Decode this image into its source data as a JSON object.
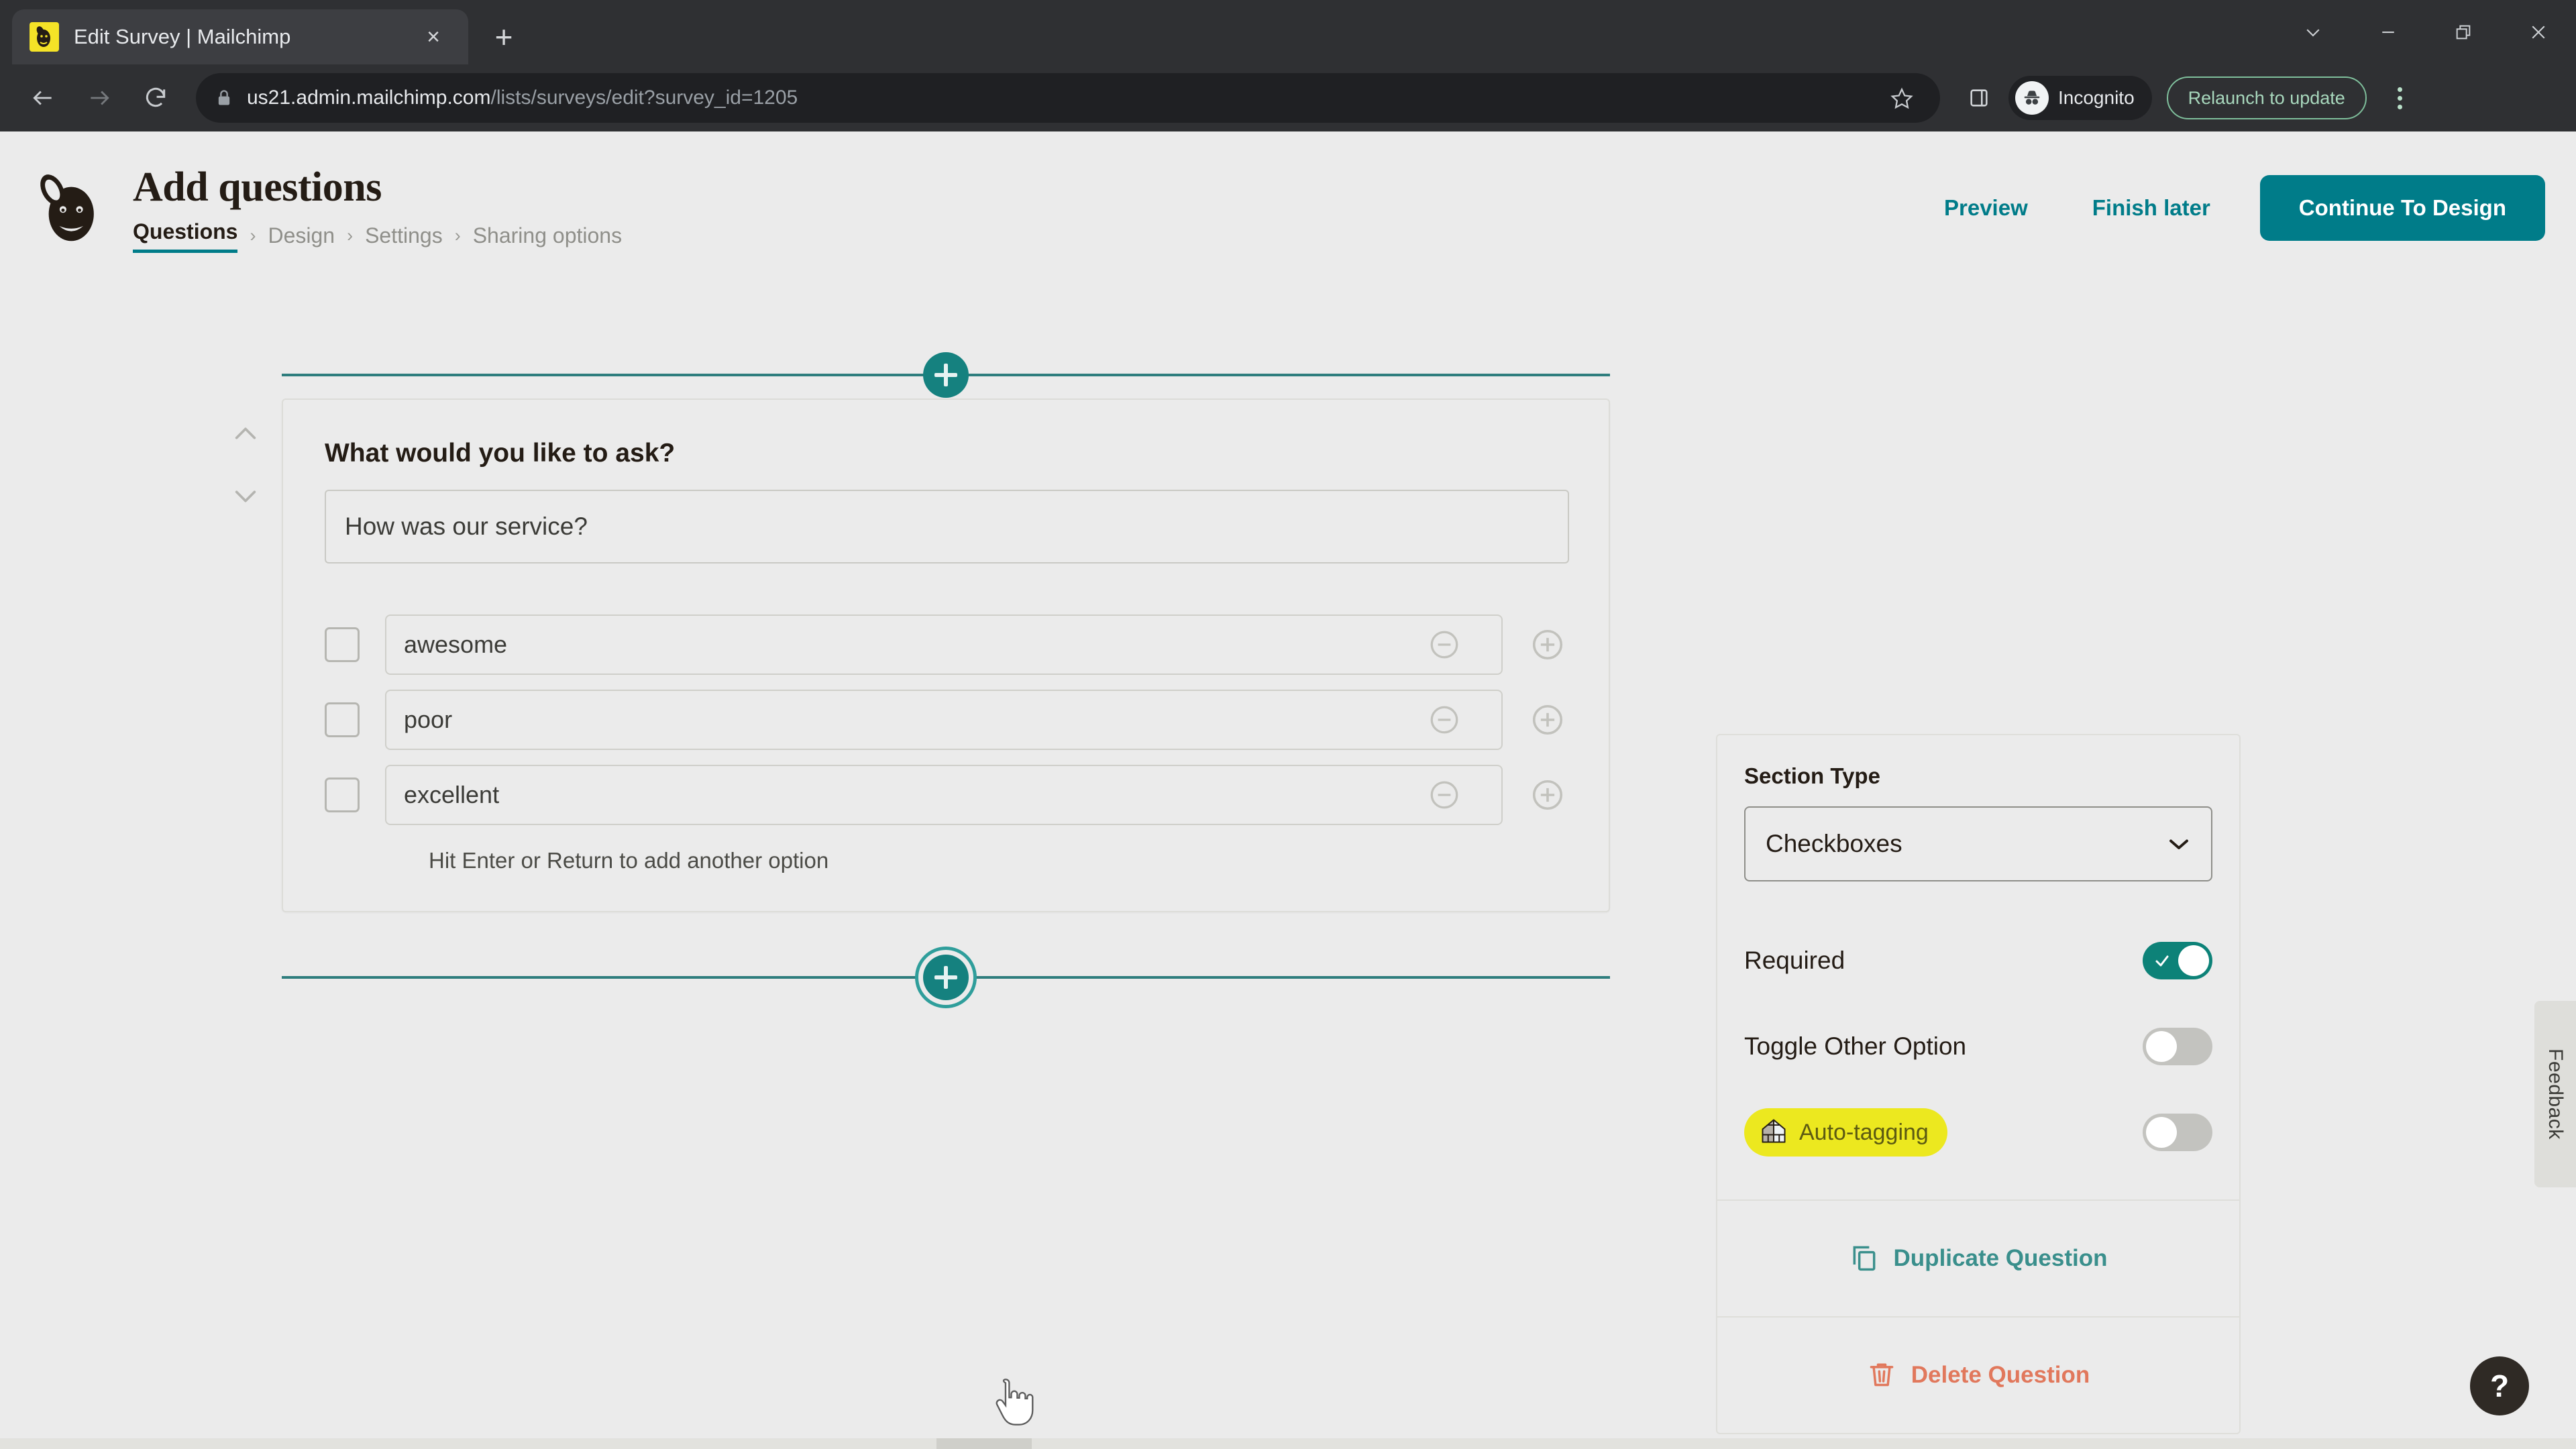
{
  "browser": {
    "tab": {
      "title": "Edit Survey | Mailchimp",
      "favicon": "mailchimp-favicon",
      "close_label": "×"
    },
    "new_tab_label": "+",
    "window_controls": {
      "minimize_to_tray": "chevron-down",
      "minimize": "minimize",
      "maximize": "restore",
      "close": "close"
    },
    "nav": {
      "back": "back-arrow",
      "forward": "forward-arrow",
      "reload": "reload-arrow"
    },
    "omnibox": {
      "lock": "lock-icon",
      "host": "us21.admin.mailchimp.com",
      "path": "/lists/surveys/edit?survey_id=1205",
      "star": "bookmark-star-icon"
    },
    "toolbar_right": {
      "side_panel": "side-panel-icon",
      "profile_label": "Incognito",
      "relaunch_label": "Relaunch to update",
      "menu": "three-dot-menu"
    }
  },
  "header": {
    "logo": "mailchimp-freddie-logo",
    "title": "Add questions",
    "breadcrumb": [
      {
        "label": "Questions",
        "active": true
      },
      {
        "label": "Design",
        "active": false
      },
      {
        "label": "Settings",
        "active": false
      },
      {
        "label": "Sharing options",
        "active": false
      }
    ],
    "separator": "›",
    "actions": {
      "preview": "Preview",
      "finish_later": "Finish later",
      "continue": "Continue To Design"
    }
  },
  "canvas": {
    "add_question_top_label": "+",
    "add_question_bottom_label": "+",
    "reorder_up": "chevron-up-icon",
    "reorder_down": "chevron-down-icon",
    "question": {
      "label": "What would you like to ask?",
      "text": "How was our service?",
      "options": [
        {
          "text": "awesome"
        },
        {
          "text": "poor"
        },
        {
          "text": "excellent"
        }
      ],
      "hint": "Hit Enter or Return to add another option",
      "remove_icon": "minus-circle-icon",
      "add_icon": "plus-circle-icon",
      "checkbox_icon": "checkbox-unchecked"
    }
  },
  "side_panel": {
    "section_type_label": "Section Type",
    "section_type_value": "Checkboxes",
    "section_type_chevron": "chevron-down-icon",
    "rows": [
      {
        "label": "Required",
        "toggle": "on",
        "badge": null
      },
      {
        "label": "Toggle Other Option",
        "toggle": "off",
        "badge": null
      },
      {
        "label": "",
        "toggle": "off",
        "badge": "Auto-tagging",
        "badge_icon": "greenhouse-icon"
      }
    ],
    "duplicate_label": "Duplicate Question",
    "duplicate_icon": "copy-icon",
    "delete_label": "Delete Question",
    "delete_icon": "trash-icon"
  },
  "floating": {
    "feedback_label": "Feedback",
    "help_label": "?"
  },
  "colors": {
    "accent_teal": "#007c89",
    "divider_teal": "#2e7d7d",
    "toggle_on": "#0d8278",
    "badge_yellow": "#ece81f",
    "delete_red": "#e1785c",
    "page_bg": "#ebebeb",
    "chrome_bg": "#2f3033"
  }
}
